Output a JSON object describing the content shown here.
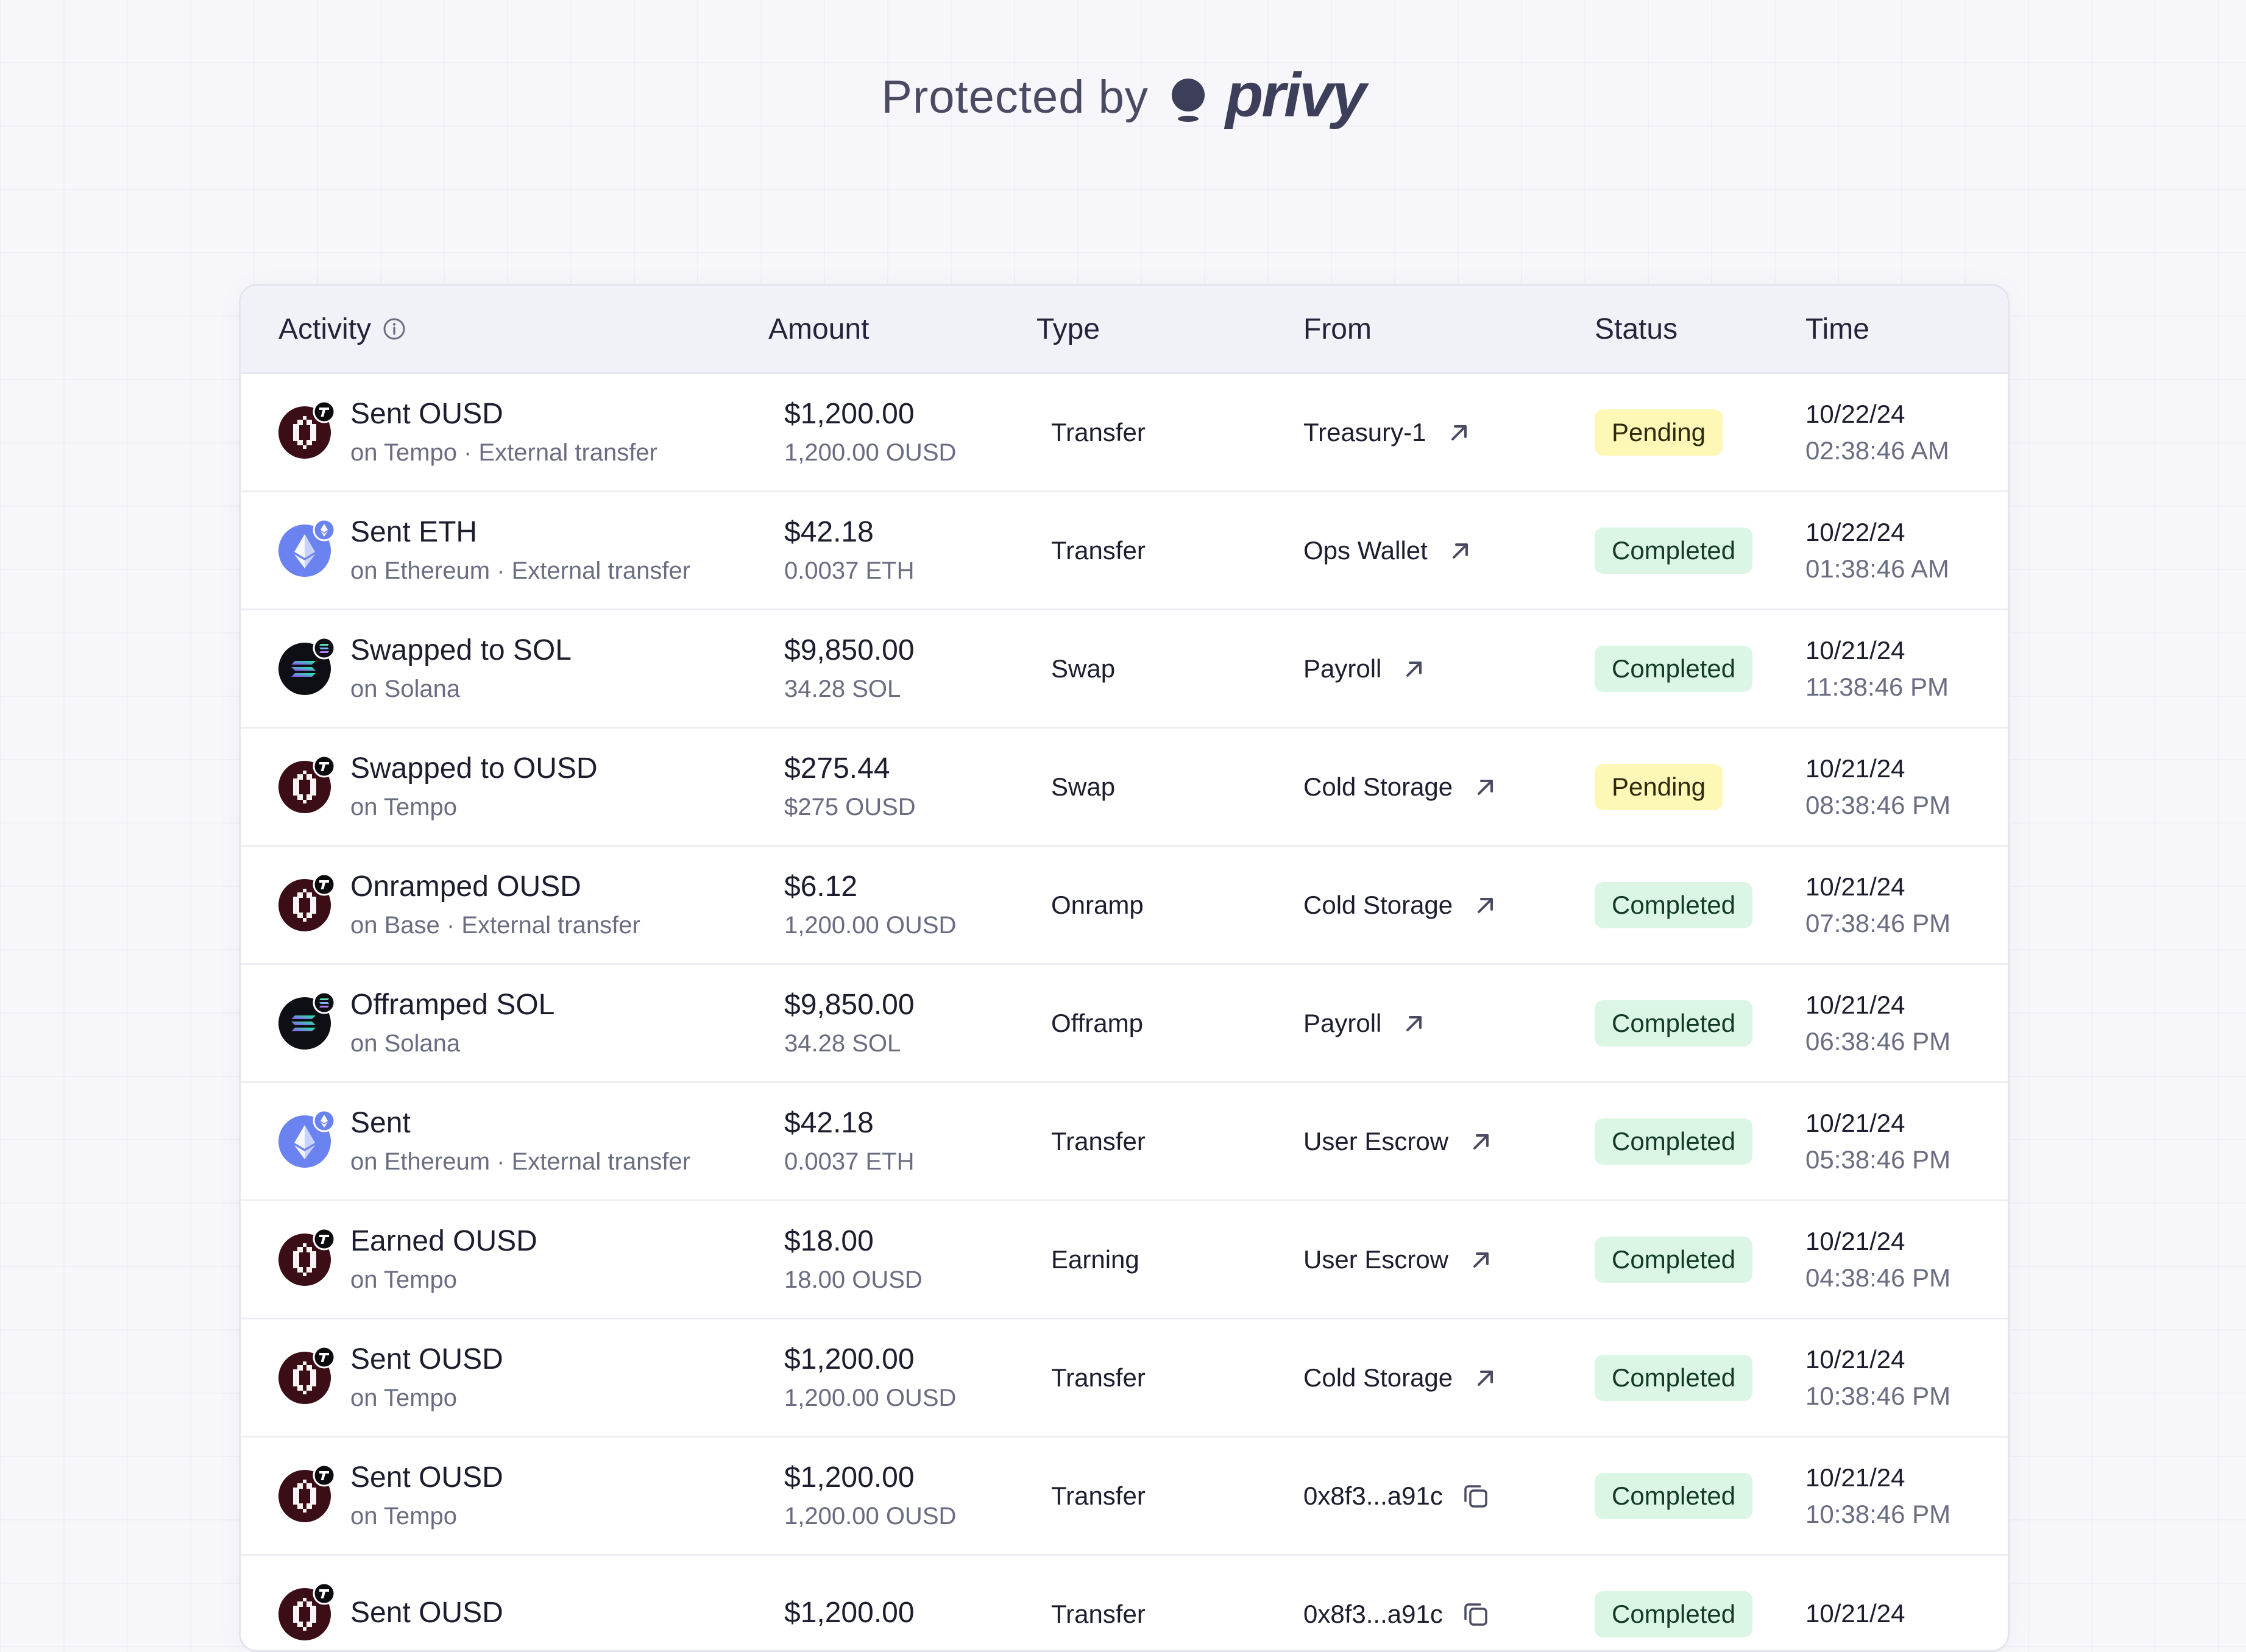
{
  "header": {
    "protected_by": "Protected by",
    "brand": "privy"
  },
  "table": {
    "columns": [
      "Activity",
      "Amount",
      "Type",
      "From",
      "Status",
      "Time"
    ],
    "rows": [
      {
        "icon": "ousd-icon",
        "chain_badge": "tempo-badge-icon",
        "title": "Sent OUSD",
        "subtitle": "on Tempo · External transfer",
        "amount_usd": "$1,200.00",
        "amount_token": "1,200.00 OUSD",
        "type": "Transfer",
        "from": "Treasury-1",
        "from_action": "external-link-icon",
        "status": "Pending",
        "date": "10/22/24",
        "clock": "02:38:46 AM"
      },
      {
        "icon": "eth-icon",
        "chain_badge": "ethereum-badge-icon",
        "title": "Sent ETH",
        "subtitle": "on Ethereum · External transfer",
        "amount_usd": "$42.18",
        "amount_token": "0.0037 ETH",
        "type": "Transfer",
        "from": "Ops Wallet",
        "from_action": "external-link-icon",
        "status": "Completed",
        "date": "10/22/24",
        "clock": "01:38:46 AM"
      },
      {
        "icon": "sol-icon",
        "chain_badge": "solana-badge-icon",
        "title": "Swapped to SOL",
        "subtitle": "on Solana",
        "amount_usd": "$9,850.00",
        "amount_token": "34.28 SOL",
        "type": "Swap",
        "from": "Payroll",
        "from_action": "external-link-icon",
        "status": "Completed",
        "date": "10/21/24",
        "clock": "11:38:46 PM"
      },
      {
        "icon": "ousd-icon",
        "chain_badge": "tempo-badge-icon",
        "title": "Swapped to OUSD",
        "subtitle": "on Tempo",
        "amount_usd": "$275.44",
        "amount_token": "$275 OUSD",
        "type": "Swap",
        "from": "Cold Storage",
        "from_action": "external-link-icon",
        "status": "Pending",
        "date": "10/21/24",
        "clock": "08:38:46 PM"
      },
      {
        "icon": "ousd-icon",
        "chain_badge": "tempo-badge-icon",
        "title": "Onramped OUSD",
        "subtitle": "on Base · External transfer",
        "amount_usd": "$6.12",
        "amount_token": "1,200.00 OUSD",
        "type": "Onramp",
        "from": "Cold Storage",
        "from_action": "external-link-icon",
        "status": "Completed",
        "date": "10/21/24",
        "clock": "07:38:46 PM"
      },
      {
        "icon": "sol-icon",
        "chain_badge": "solana-badge-icon",
        "title": "Offramped SOL",
        "subtitle": "on Solana",
        "amount_usd": "$9,850.00",
        "amount_token": "34.28 SOL",
        "type": "Offramp",
        "from": "Payroll",
        "from_action": "external-link-icon",
        "status": "Completed",
        "date": "10/21/24",
        "clock": "06:38:46 PM"
      },
      {
        "icon": "eth-icon",
        "chain_badge": "ethereum-badge-icon",
        "title": "Sent",
        "subtitle": "on Ethereum · External transfer",
        "amount_usd": "$42.18",
        "amount_token": "0.0037 ETH",
        "type": "Transfer",
        "from": "User Escrow",
        "from_action": "external-link-icon",
        "status": "Completed",
        "date": "10/21/24",
        "clock": "05:38:46 PM"
      },
      {
        "icon": "ousd-icon",
        "chain_badge": "tempo-badge-icon",
        "title": "Earned OUSD",
        "subtitle": "on Tempo",
        "amount_usd": "$18.00",
        "amount_token": "18.00 OUSD",
        "type": "Earning",
        "from": "User Escrow",
        "from_action": "external-link-icon",
        "status": "Completed",
        "date": "10/21/24",
        "clock": "04:38:46 PM"
      },
      {
        "icon": "ousd-icon",
        "chain_badge": "tempo-badge-icon",
        "title": "Sent OUSD",
        "subtitle": "on Tempo",
        "amount_usd": "$1,200.00",
        "amount_token": "1,200.00 OUSD",
        "type": "Transfer",
        "from": "Cold Storage",
        "from_action": "external-link-icon",
        "status": "Completed",
        "date": "10/21/24",
        "clock": "10:38:46 PM"
      },
      {
        "icon": "ousd-icon",
        "chain_badge": "tempo-badge-icon",
        "title": "Sent OUSD",
        "subtitle": "on Tempo",
        "amount_usd": "$1,200.00",
        "amount_token": "1,200.00 OUSD",
        "type": "Transfer",
        "from": "0x8f3...a91c",
        "from_action": "copy-icon",
        "status": "Completed",
        "date": "10/21/24",
        "clock": "10:38:46 PM"
      },
      {
        "icon": "ousd-icon",
        "chain_badge": "tempo-badge-icon",
        "title": "Sent OUSD",
        "subtitle": "",
        "amount_usd": "$1,200.00",
        "amount_token": "",
        "type": "Transfer",
        "from": "0x8f3...a91c",
        "from_action": "copy-icon",
        "status": "Completed",
        "date": "10/21/24",
        "clock": ""
      }
    ]
  },
  "colors": {
    "pending_bg": "#fdf8b5",
    "completed_bg": "#dcf6e6",
    "eth_blue": "#6b83f0",
    "ousd_maroon": "#3b0d16",
    "brand_ink": "#3c3e5a"
  }
}
